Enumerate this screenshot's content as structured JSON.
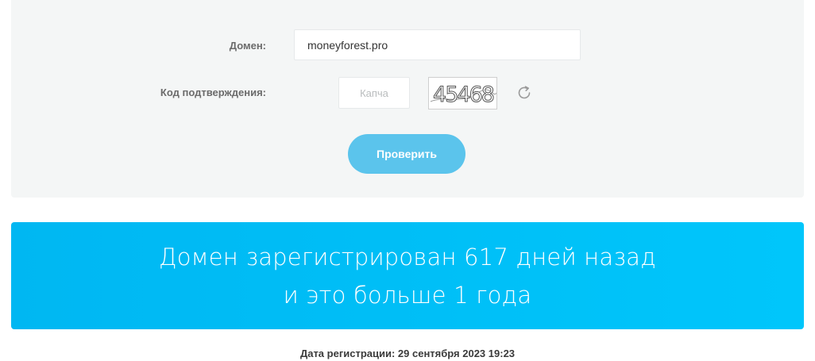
{
  "form": {
    "domain_label": "Домен:",
    "domain_value": "moneyforest.pro",
    "code_label": "Код подтверждения:",
    "captcha_placeholder": "Капча",
    "captcha_text": "45468",
    "submit_label": "Проверить",
    "refresh_icon": "refresh-icon"
  },
  "result": {
    "line1": "Домен зарегистрирован 617 дней назад",
    "line2": "и это больше 1 года"
  },
  "registration": {
    "text": "Дата регистрации: 29 сентября 2023 19:23"
  },
  "colors": {
    "button": "#5bc4ec",
    "banner": "#00bff8",
    "panel": "#f4f6f6"
  }
}
